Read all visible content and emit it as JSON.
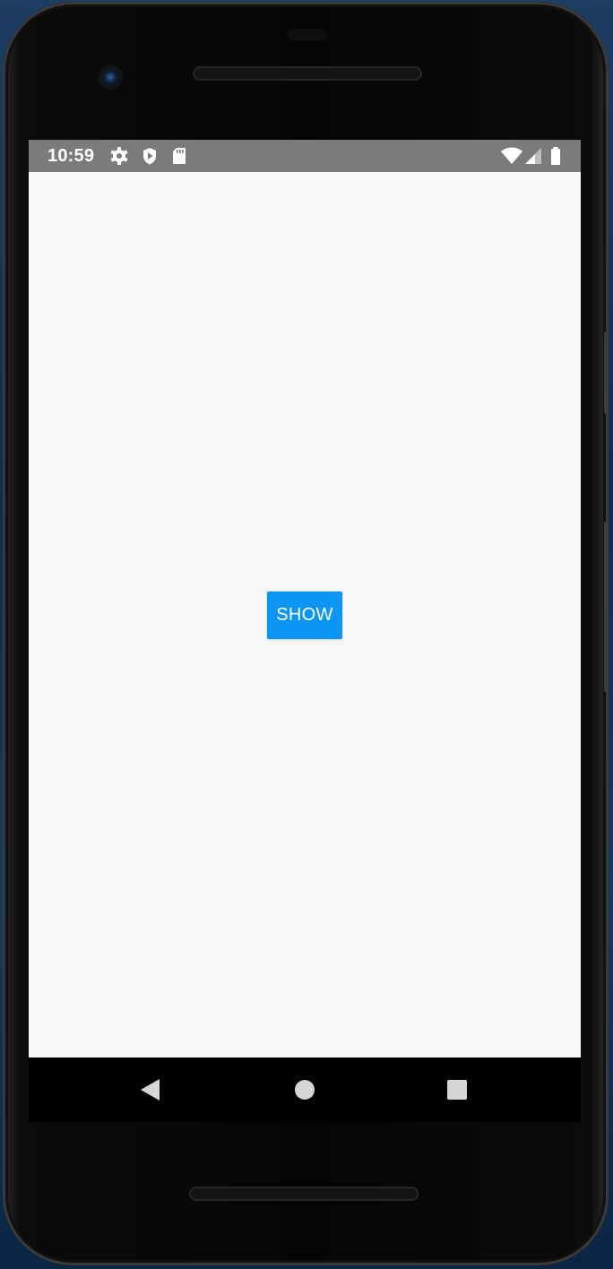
{
  "status_bar": {
    "time": "10:59",
    "left_icons": [
      "settings-icon",
      "shield-icon",
      "sd-card-icon"
    ],
    "right_icons": [
      "wifi-icon",
      "cellular-signal-icon",
      "battery-icon"
    ],
    "background_color": "#7b7b7b"
  },
  "main": {
    "show_button_label": "SHOW",
    "button_color": "#0b96f5",
    "background_color": "#f7f8f8"
  },
  "nav_bar": {
    "buttons": [
      "back-icon",
      "home-icon",
      "recents-icon"
    ]
  }
}
